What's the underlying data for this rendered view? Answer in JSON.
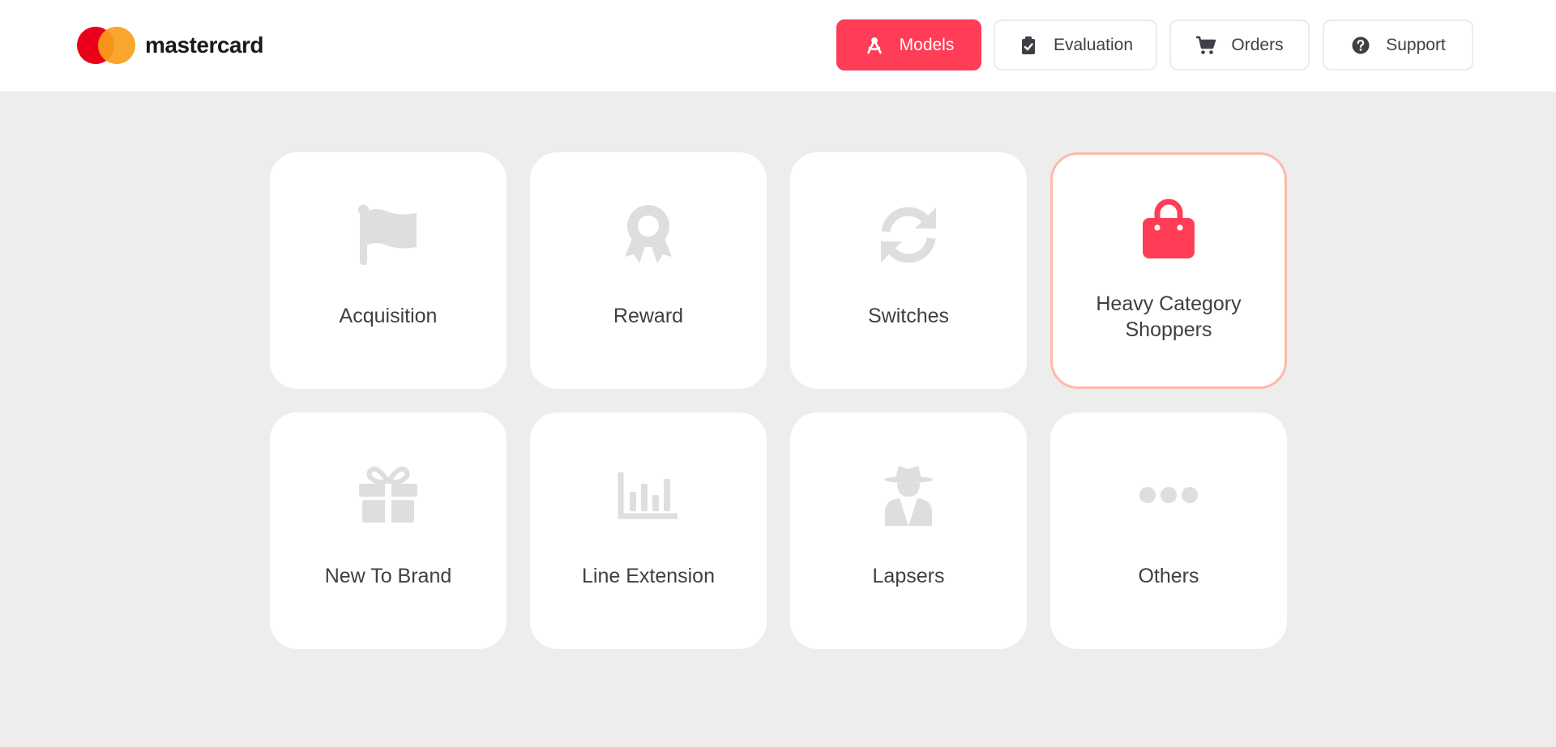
{
  "brand": {
    "name": "mastercard"
  },
  "nav": {
    "items": [
      {
        "label": "Models",
        "icon": "compass-drafting-icon",
        "active": true
      },
      {
        "label": "Evaluation",
        "icon": "clipboard-check-icon",
        "active": false
      },
      {
        "label": "Orders",
        "icon": "shopping-cart-icon",
        "active": false
      },
      {
        "label": "Support",
        "icon": "question-circle-icon",
        "active": false
      }
    ]
  },
  "models": [
    {
      "label": "Acquisition",
      "icon": "flag-icon",
      "selected": false
    },
    {
      "label": "Reward",
      "icon": "award-ribbon-icon",
      "selected": false
    },
    {
      "label": "Switches",
      "icon": "sync-arrows-icon",
      "selected": false
    },
    {
      "label": "Heavy Category Shoppers",
      "icon": "shopping-bag-icon",
      "selected": true
    },
    {
      "label": "New To Brand",
      "icon": "gift-icon",
      "selected": false
    },
    {
      "label": "Line Extension",
      "icon": "bar-chart-icon",
      "selected": false
    },
    {
      "label": "Lapsers",
      "icon": "user-secret-icon",
      "selected": false
    },
    {
      "label": "Others",
      "icon": "ellipsis-icon",
      "selected": false
    }
  ],
  "colors": {
    "accent": "#ff3d57",
    "icon_muted": "#dedede",
    "card_selected_border": "#ffb8ad",
    "background": "#ededed"
  }
}
